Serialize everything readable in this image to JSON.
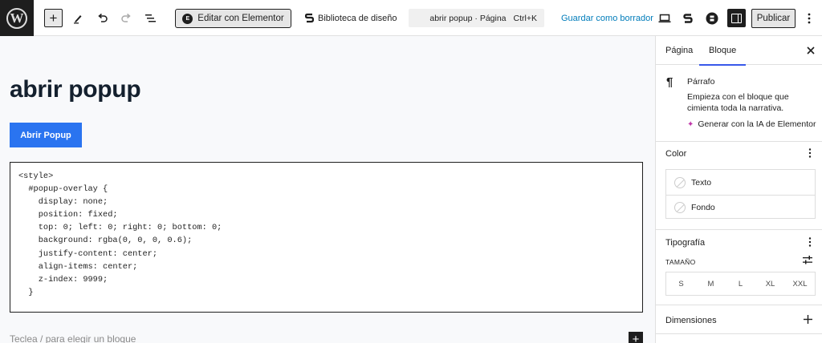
{
  "toolbar": {
    "wp_logo_letter": "W",
    "inserter_glyph": "+",
    "elementor_label": "Editar con Elementor",
    "elementor_icon_glyph": "E",
    "library_label": "Biblioteca de diseño",
    "command": {
      "title": "abrir popup · Página",
      "shortcut": "Ctrl+K"
    },
    "save_draft_label": "Guardar como borrador",
    "publish_label": "Publicar",
    "icons": [
      "wordpress-logo",
      "add-block",
      "edit-tool",
      "undo",
      "redo",
      "document-overview",
      "preview-desktop",
      "elementor-library",
      "ai-assistant",
      "settings-sidebar",
      "options"
    ]
  },
  "canvas": {
    "title": "abrir popup",
    "button_label": "Abrir Popup",
    "code": "<style>\n  #popup-overlay {\n    display: none;\n    position: fixed;\n    top: 0; left: 0; right: 0; bottom: 0;\n    background: rgba(0, 0, 0, 0.6);\n    justify-content: center;\n    align-items: center;\n    z-index: 9999;\n  }",
    "placeholder": "Teclea / para elegir un bloque",
    "add_glyph": "+"
  },
  "sidebar": {
    "tabs": [
      {
        "label": "Página",
        "active": false
      },
      {
        "label": "Bloque",
        "active": true
      }
    ],
    "block": {
      "name": "Párrafo",
      "description": "Empieza con el bloque que cimienta toda la narrativa.",
      "ai_label": "Generar con la IA de Elementor"
    },
    "color": {
      "title": "Color",
      "items": [
        "Texto",
        "Fondo"
      ]
    },
    "typography": {
      "title": "Tipografía",
      "size_label": "TAMAÑO",
      "sizes": [
        "S",
        "M",
        "L",
        "XL",
        "XXL"
      ]
    },
    "dimensions": {
      "title": "Dimensiones"
    }
  },
  "colors": {
    "accent": "#3858e9",
    "button_blue": "#2a74f0",
    "link_blue": "#007cba",
    "dark": "#1e1e1e",
    "ai_pink": "#c036a9"
  }
}
